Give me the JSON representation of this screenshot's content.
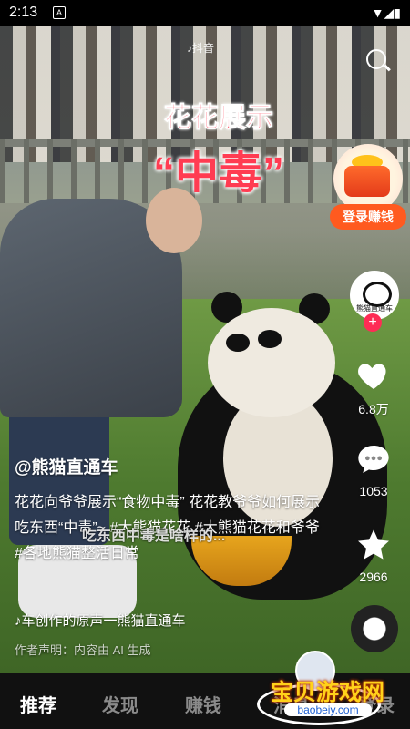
{
  "status_bar": {
    "time": "2:13",
    "a_icon": "A",
    "signal_icons": "▼◢▮"
  },
  "video": {
    "watermark": "♪抖音",
    "overlay_title_line1": "花花展示",
    "overlay_title_line2": "“中毒”",
    "burned_subtitle": "吃东西中毒是啥样的..."
  },
  "promo": {
    "label": "登录赚钱"
  },
  "author_avatar": {
    "name": "熊猫直通车"
  },
  "side_actions": {
    "like_count": "6.8万",
    "comment_count": "1053",
    "favorite_count": "2966"
  },
  "caption": {
    "author": "@熊猫直通车",
    "description": "花花向爷爷展示“食物中毒” 花花教爷爷如何展示吃东西“中毒”~ #大熊猫花花 #大熊猫花花和爷爷 #各地熊猫整活日常",
    "music": "♪车创作的原声一熊猫直通车",
    "notice": "作者声明：内容由 AI 生成"
  },
  "tabs": [
    {
      "label": "推荐"
    },
    {
      "label": "发现"
    },
    {
      "label": "赚钱"
    },
    {
      "label": "消息"
    },
    {
      "label": "登录"
    }
  ],
  "brand_watermark": {
    "text": "宝贝游戏网",
    "url": "baobeiy.com"
  }
}
